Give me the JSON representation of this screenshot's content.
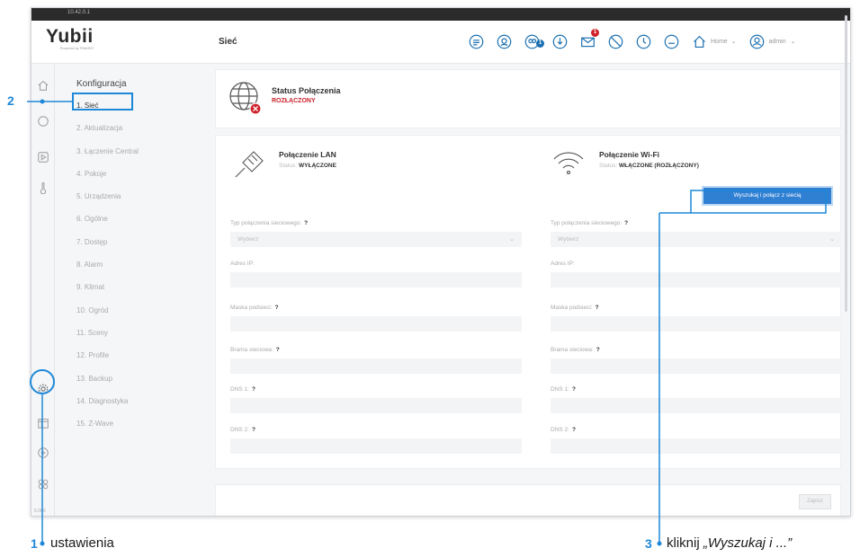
{
  "window": {
    "ip": "10.42.0.1"
  },
  "app": {
    "logo": "Yubii",
    "logo_sub": "Powered by FIBARO",
    "page_title": "Sieć"
  },
  "topnav": {
    "home_label": "Home",
    "admin_label": "admin",
    "notification_badge": "1",
    "user_badge": "1",
    "accent": "#1a6fb0"
  },
  "rail": {
    "version": "5.060"
  },
  "menu": {
    "heading": "Konfiguracja",
    "items": [
      "1. Sieć",
      "2. Aktualizacja",
      "3. Łączenie Central",
      "4. Pokoje",
      "5. Urządzenia",
      "6. Ogólne",
      "7. Dostęp",
      "8. Alarm",
      "9. Klimat",
      "10. Ogród",
      "11. Sceny",
      "12. Profile",
      "13. Backup",
      "14. Diagnostyka",
      "15. Z-Wave"
    ]
  },
  "status": {
    "title": "Status Połączenia",
    "state": "ROZŁĄCZONY",
    "state_color": "#c8222b"
  },
  "lan": {
    "title": "Połączenie LAN",
    "status_prefix": "Status:",
    "status_value": "WYŁĄCZONE",
    "type_label": "Typ połączenia sieciowego:",
    "select_value": "Wybierz",
    "ip_label": "Adres IP:",
    "mask_label": "Maska podsieci:",
    "gateway_label": "Brama sieciowa:",
    "dns1_label": "DNS 1:",
    "dns2_label": "DNS 2:",
    "help": "?"
  },
  "wifi": {
    "title": "Połączenie Wi-Fi",
    "status_prefix": "Status:",
    "status_value": "WŁĄCZONE (ROZŁĄCZONY)",
    "search_button": "Wyszukaj i połącz z siecią",
    "type_label": "Typ połączenia sieciowego:",
    "select_value": "Wybierz",
    "ip_label": "Adres IP:",
    "mask_label": "Maska podsieci:",
    "gateway_label": "Brama sieciowa:",
    "dns1_label": "DNS 1:",
    "dns2_label": "DNS 2:",
    "help": "?"
  },
  "footer": {
    "save_label": "Zapisz"
  },
  "annotations": {
    "n1": "1",
    "t1": "ustawienia",
    "n2": "2",
    "n3": "3",
    "t3_prefix": "kliknij ",
    "t3_italic": "„Wyszukaj i ...”",
    "color": "#1e88d8"
  }
}
